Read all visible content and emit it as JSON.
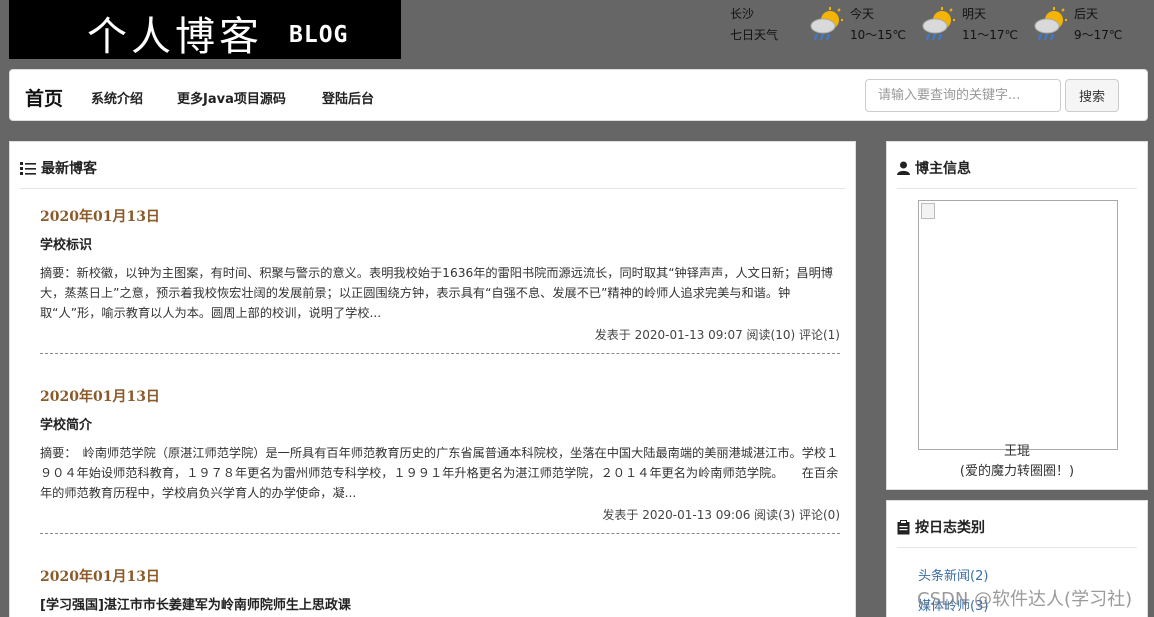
{
  "logo": {
    "title": "个人博客",
    "subtitle": "BLOG"
  },
  "weather": {
    "city": "长沙",
    "forecast_label": "七日天气",
    "days": [
      {
        "day": "今天",
        "temp": "10～15℃",
        "icon": "rain-cloud-icon"
      },
      {
        "day": "明天",
        "temp": "11～17℃",
        "icon": "rain-cloud-icon"
      },
      {
        "day": "后天",
        "temp": "9～17℃",
        "icon": "rain-cloud-icon"
      }
    ]
  },
  "nav": {
    "home": "首页",
    "links": [
      "系统介绍",
      "更多Java项目源码",
      "登陆后台"
    ],
    "search_placeholder": "请输入要查询的关键字...",
    "search_button": "搜索"
  },
  "main": {
    "heading": "最新博客",
    "posts": [
      {
        "date": "2020年01月13日",
        "title": "学校标识",
        "summary": "摘要：新校徽，以钟为主图案，有时间、积聚与警示的意义。表明我校始于1636年的雷阳书院而源远流长，同时取其“钟铎声声，人文日新；昌明博大，蒸蒸日上”之意，预示着我校恢宏壮阔的发展前景；以正圆围绕方钟，表示具有“自强不息、发展不已”精神的岭师人追求完美与和谐。钟取“人”形，喻示教育以人为本。圆周上部的校训，说明了学校...",
        "meta": "发表于 2020-01-13 09:07 阅读(10) 评论(1)"
      },
      {
        "date": "2020年01月13日",
        "title": "学校简介",
        "summary": "摘要：　岭南师范学院（原湛江师范学院）是一所具有百年师范教育历史的广东省属普通本科院校，坐落在中国大陆最南端的美丽港城湛江市。学校１９０４年始设师范科教育，１９７８年更名为雷州师范专科学校，１９９１年升格更名为湛江师范学院，２０１４年更名为岭南师范学院。　　在百余年的师范教育历程中，学校肩负兴学育人的办学使命，凝...",
        "meta": "发表于 2020-01-13 09:06 阅读(3) 评论(0)"
      },
      {
        "date": "2020年01月13日",
        "title": "[学习强国]湛江市市长姜建军为岭南师院师生上思政课",
        "summary": "",
        "meta": ""
      }
    ]
  },
  "blogger": {
    "heading": "博主信息",
    "name": "王琨",
    "signature": "(爱的魔力转圈圈！)"
  },
  "categories": {
    "heading": "按日志类别",
    "items": [
      "头条新闻(2)",
      "媒体岭师(3)"
    ]
  },
  "watermark": "CSDN @软件达人(学习社)"
}
